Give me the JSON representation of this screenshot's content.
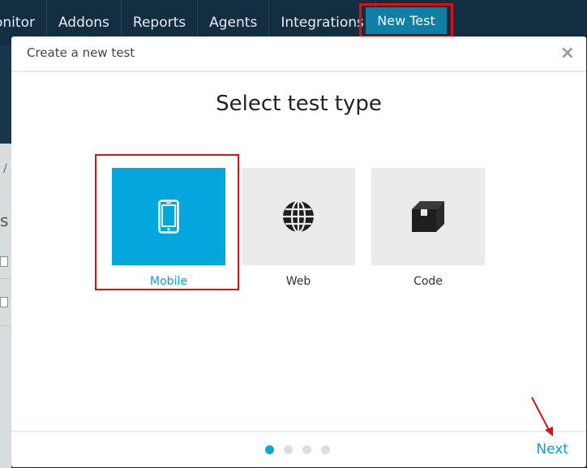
{
  "nav": {
    "items": [
      "onitor",
      "Addons",
      "Reports",
      "Agents",
      "Integrations"
    ],
    "new_test_label": "New Test"
  },
  "background": {
    "breadcrumb_slash": "/",
    "partial_heading": "s"
  },
  "modal": {
    "title": "Create a new test",
    "close_label": "×",
    "heading": "Select test type",
    "options": [
      {
        "label": "Mobile",
        "icon": "smartphone-icon",
        "selected": true
      },
      {
        "label": "Web",
        "icon": "globe-icon",
        "selected": false
      },
      {
        "label": "Code",
        "icon": "box-icon",
        "selected": false
      }
    ],
    "steps": {
      "total": 4,
      "current": 1
    },
    "next_label": "Next"
  },
  "colors": {
    "accent": "#04a7dd",
    "highlight": "#e01010",
    "nav_bg": "#132e40",
    "new_test_bg": "#0f7fa6"
  }
}
